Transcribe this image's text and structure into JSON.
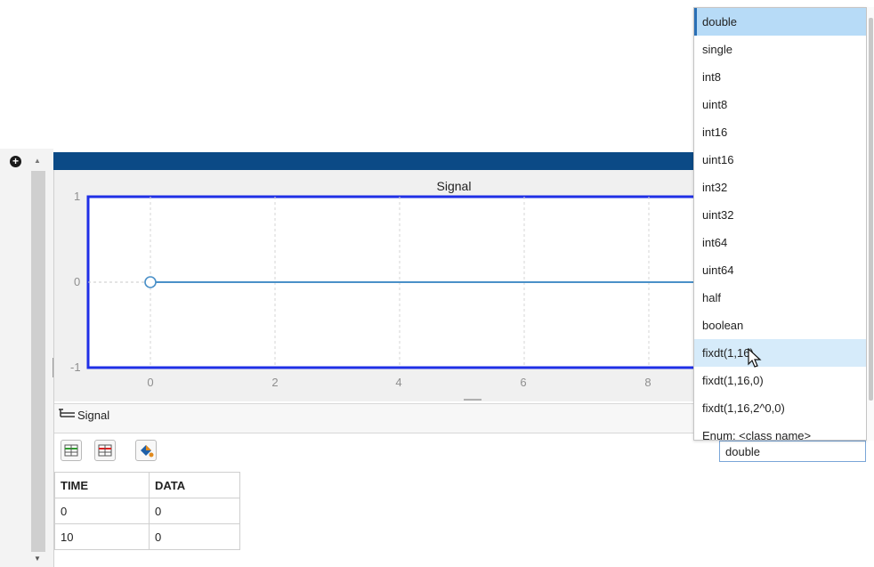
{
  "left_strip": {
    "add_icon": "plus-circle-icon"
  },
  "plot": {
    "title": "Signal",
    "y_ticks": [
      "1",
      "0",
      "-1"
    ],
    "x_ticks": [
      "0",
      "2",
      "4",
      "6",
      "8"
    ],
    "colors": {
      "frame": "#1f2fe6",
      "line": "#4a90c8",
      "header": "#0b4a86"
    }
  },
  "chart_data": {
    "type": "line",
    "title": "Signal",
    "xlabel": "",
    "ylabel": "",
    "xlim": [
      -1,
      10
    ],
    "ylim": [
      -1,
      1
    ],
    "grid": true,
    "series": [
      {
        "x": [
          0,
          10
        ],
        "y": [
          0,
          0
        ]
      }
    ]
  },
  "signal_bar": {
    "label": "Signal",
    "icon": "signal-branch-icon"
  },
  "toolbar": {
    "insert_row_icon": "table-insert-row-icon",
    "delete_row_icon": "table-delete-row-icon",
    "paint_icon": "paint-bucket-icon"
  },
  "datatype_input": {
    "value": "double"
  },
  "table": {
    "headers": [
      "TIME",
      "DATA"
    ],
    "rows": [
      [
        "0",
        "0"
      ],
      [
        "10",
        "0"
      ]
    ]
  },
  "dropdown": {
    "options": [
      "double",
      "single",
      "int8",
      "uint8",
      "int16",
      "uint16",
      "int32",
      "uint32",
      "int64",
      "uint64",
      "half",
      "boolean",
      "fixdt(1,16)",
      "fixdt(1,16,0)",
      "fixdt(1,16,2^0,0)",
      "Enum: <class name>"
    ],
    "selected": "double",
    "hovered": "fixdt(1,16)"
  }
}
